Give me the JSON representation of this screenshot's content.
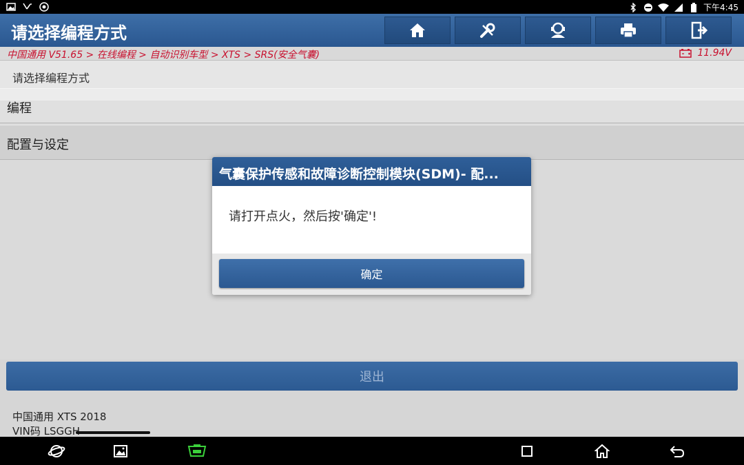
{
  "status_bar": {
    "time": "下午4:45",
    "left_icons": [
      "image-icon",
      "usb-icon",
      "settings-icon"
    ],
    "right_icons": [
      "bluetooth-icon",
      "dnd-icon",
      "wifi-icon",
      "signal-icon",
      "battery-icon"
    ]
  },
  "header": {
    "title": "请选择编程方式",
    "toolbar": [
      "home-icon",
      "diagnostic-tools-icon",
      "user-icon",
      "printer-icon",
      "exit-icon"
    ]
  },
  "breadcrumb": {
    "path": "中国通用 V51.65 > 在线编程 > 自动识别车型 > XTS > SRS(安全气囊)",
    "voltage": "11.94V"
  },
  "content": {
    "section_label": "请选择编程方式",
    "items": [
      {
        "label": "编程"
      },
      {
        "label": "配置与设定"
      }
    ]
  },
  "exit_button": "退出",
  "footer": {
    "vehicle": "中国通用 XTS 2018",
    "vin": "VIN码 LSGGH"
  },
  "dialog": {
    "title": "气囊保护传感和故障诊断控制模块(SDM)- 配...",
    "message": "请打开点火，然后按'确定'!",
    "ok_label": "确定"
  },
  "nav_bar": [
    "browser-icon",
    "gallery-icon",
    "vci-icon",
    "recent-apps-icon",
    "home-nav-icon",
    "back-icon"
  ],
  "colors": {
    "header_blue": "#2a5790",
    "breadcrumb_red": "#c8102e",
    "vci_green": "#3bd13b"
  }
}
